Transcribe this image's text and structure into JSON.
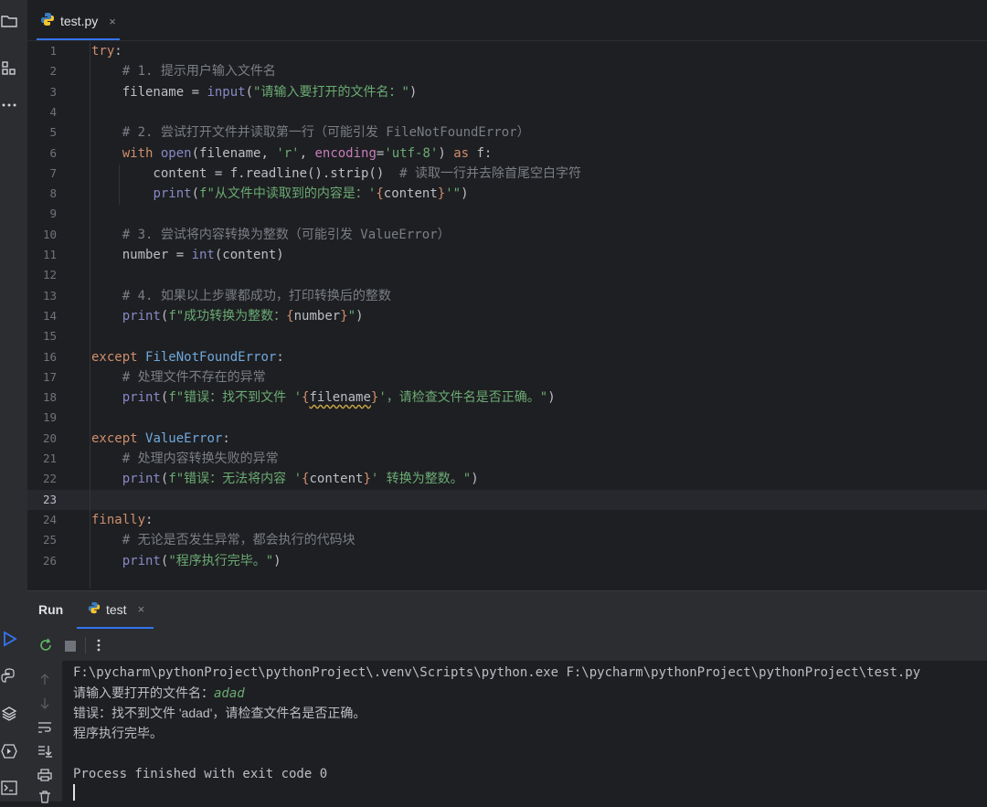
{
  "editor_tab": {
    "filename": "test.py",
    "close": "×"
  },
  "code_lines": [
    [
      {
        "t": "try",
        "c": "kw"
      },
      {
        "t": ":"
      }
    ],
    [
      {
        "t": "    # 1. 提示用户输入文件名",
        "c": "cmt"
      }
    ],
    [
      {
        "t": "    filename = "
      },
      {
        "t": "input",
        "c": "bi"
      },
      {
        "t": "("
      },
      {
        "t": "\"请输入要打开的文件名：\"",
        "c": "str"
      },
      {
        "t": ")"
      }
    ],
    [],
    [
      {
        "t": "    # 2. 尝试打开文件并读取第一行（可能引发 FileNotFoundError）",
        "c": "cmt"
      }
    ],
    [
      {
        "t": "    "
      },
      {
        "t": "with",
        "c": "kw"
      },
      {
        "t": " "
      },
      {
        "t": "open",
        "c": "bi"
      },
      {
        "t": "(filename, "
      },
      {
        "t": "'r'",
        "c": "str"
      },
      {
        "t": ", "
      },
      {
        "t": "encoding",
        "c": "pname"
      },
      {
        "t": "="
      },
      {
        "t": "'utf-8'",
        "c": "str"
      },
      {
        "t": ") "
      },
      {
        "t": "as",
        "c": "kw"
      },
      {
        "t": " f:"
      }
    ],
    [
      {
        "t": "        content = f.readline().strip()  "
      },
      {
        "t": "# 读取一行并去除首尾空白字符",
        "c": "cmt"
      }
    ],
    [
      {
        "t": "        "
      },
      {
        "t": "print",
        "c": "bi"
      },
      {
        "t": "("
      },
      {
        "t": "f\"从文件中读取到的内容是：'",
        "c": "str"
      },
      {
        "t": "{",
        "c": "brace"
      },
      {
        "t": "content"
      },
      {
        "t": "}",
        "c": "brace"
      },
      {
        "t": "'\"",
        "c": "str"
      },
      {
        "t": ")"
      }
    ],
    [],
    [
      {
        "t": "    # 3. 尝试将内容转换为整数（可能引发 ValueError）",
        "c": "cmt"
      }
    ],
    [
      {
        "t": "    number = "
      },
      {
        "t": "int",
        "c": "bi"
      },
      {
        "t": "(content)"
      }
    ],
    [],
    [
      {
        "t": "    # 4. 如果以上步骤都成功，打印转换后的整数",
        "c": "cmt"
      }
    ],
    [
      {
        "t": "    "
      },
      {
        "t": "print",
        "c": "bi"
      },
      {
        "t": "("
      },
      {
        "t": "f\"成功转换为整数：",
        "c": "str"
      },
      {
        "t": "{",
        "c": "brace"
      },
      {
        "t": "number"
      },
      {
        "t": "}",
        "c": "brace"
      },
      {
        "t": "\"",
        "c": "str"
      },
      {
        "t": ")"
      }
    ],
    [],
    [
      {
        "t": "except",
        "c": "kw"
      },
      {
        "t": " "
      },
      {
        "t": "FileNotFoundError",
        "c": "cls"
      },
      {
        "t": ":"
      }
    ],
    [
      {
        "t": "    # 处理文件不存在的异常",
        "c": "cmt"
      }
    ],
    [
      {
        "t": "    "
      },
      {
        "t": "print",
        "c": "bi"
      },
      {
        "t": "("
      },
      {
        "t": "f\"错误：找不到文件 '",
        "c": "str"
      },
      {
        "t": "{",
        "c": "brace"
      },
      {
        "t": "filename",
        "c": "squig"
      },
      {
        "t": "}",
        "c": "brace"
      },
      {
        "t": "'，请检查文件名是否正确。\"",
        "c": "str"
      },
      {
        "t": ")"
      }
    ],
    [],
    [
      {
        "t": "except",
        "c": "kw"
      },
      {
        "t": " "
      },
      {
        "t": "ValueError",
        "c": "cls"
      },
      {
        "t": ":"
      }
    ],
    [
      {
        "t": "    # 处理内容转换失败的异常",
        "c": "cmt"
      }
    ],
    [
      {
        "t": "    "
      },
      {
        "t": "print",
        "c": "bi"
      },
      {
        "t": "("
      },
      {
        "t": "f\"错误：无法将内容 '",
        "c": "str"
      },
      {
        "t": "{",
        "c": "brace"
      },
      {
        "t": "content"
      },
      {
        "t": "}",
        "c": "brace"
      },
      {
        "t": "' 转换为整数。\"",
        "c": "str"
      },
      {
        "t": ")"
      }
    ],
    [],
    [
      {
        "t": "finally",
        "c": "kw"
      },
      {
        "t": ":"
      }
    ],
    [
      {
        "t": "    # 无论是否发生异常，都会执行的代码块",
        "c": "cmt"
      }
    ],
    [
      {
        "t": "    "
      },
      {
        "t": "print",
        "c": "bi"
      },
      {
        "t": "("
      },
      {
        "t": "\"程序执行完毕。\"",
        "c": "str"
      },
      {
        "t": ")"
      }
    ]
  ],
  "current_line": 23,
  "run_panel": {
    "title": "Run",
    "tab_label": "test",
    "tab_close": "×"
  },
  "console": {
    "command": "F:\\pycharm\\pythonProject\\pythonProject\\.venv\\Scripts\\python.exe F:\\pycharm\\pythonProject\\pythonProject\\test.py",
    "prompt": "请输入要打开的文件名：",
    "input": "adad",
    "error": "错误：找不到文件 'adad'，请检查文件名是否正确。",
    "finished_msg": "程序执行完毕。",
    "exit": "Process finished with exit code 0"
  },
  "colors": {
    "accent": "#3574f0",
    "keyword": "#cf8e6d",
    "string": "#6aab73",
    "comment": "#7a7e85"
  }
}
